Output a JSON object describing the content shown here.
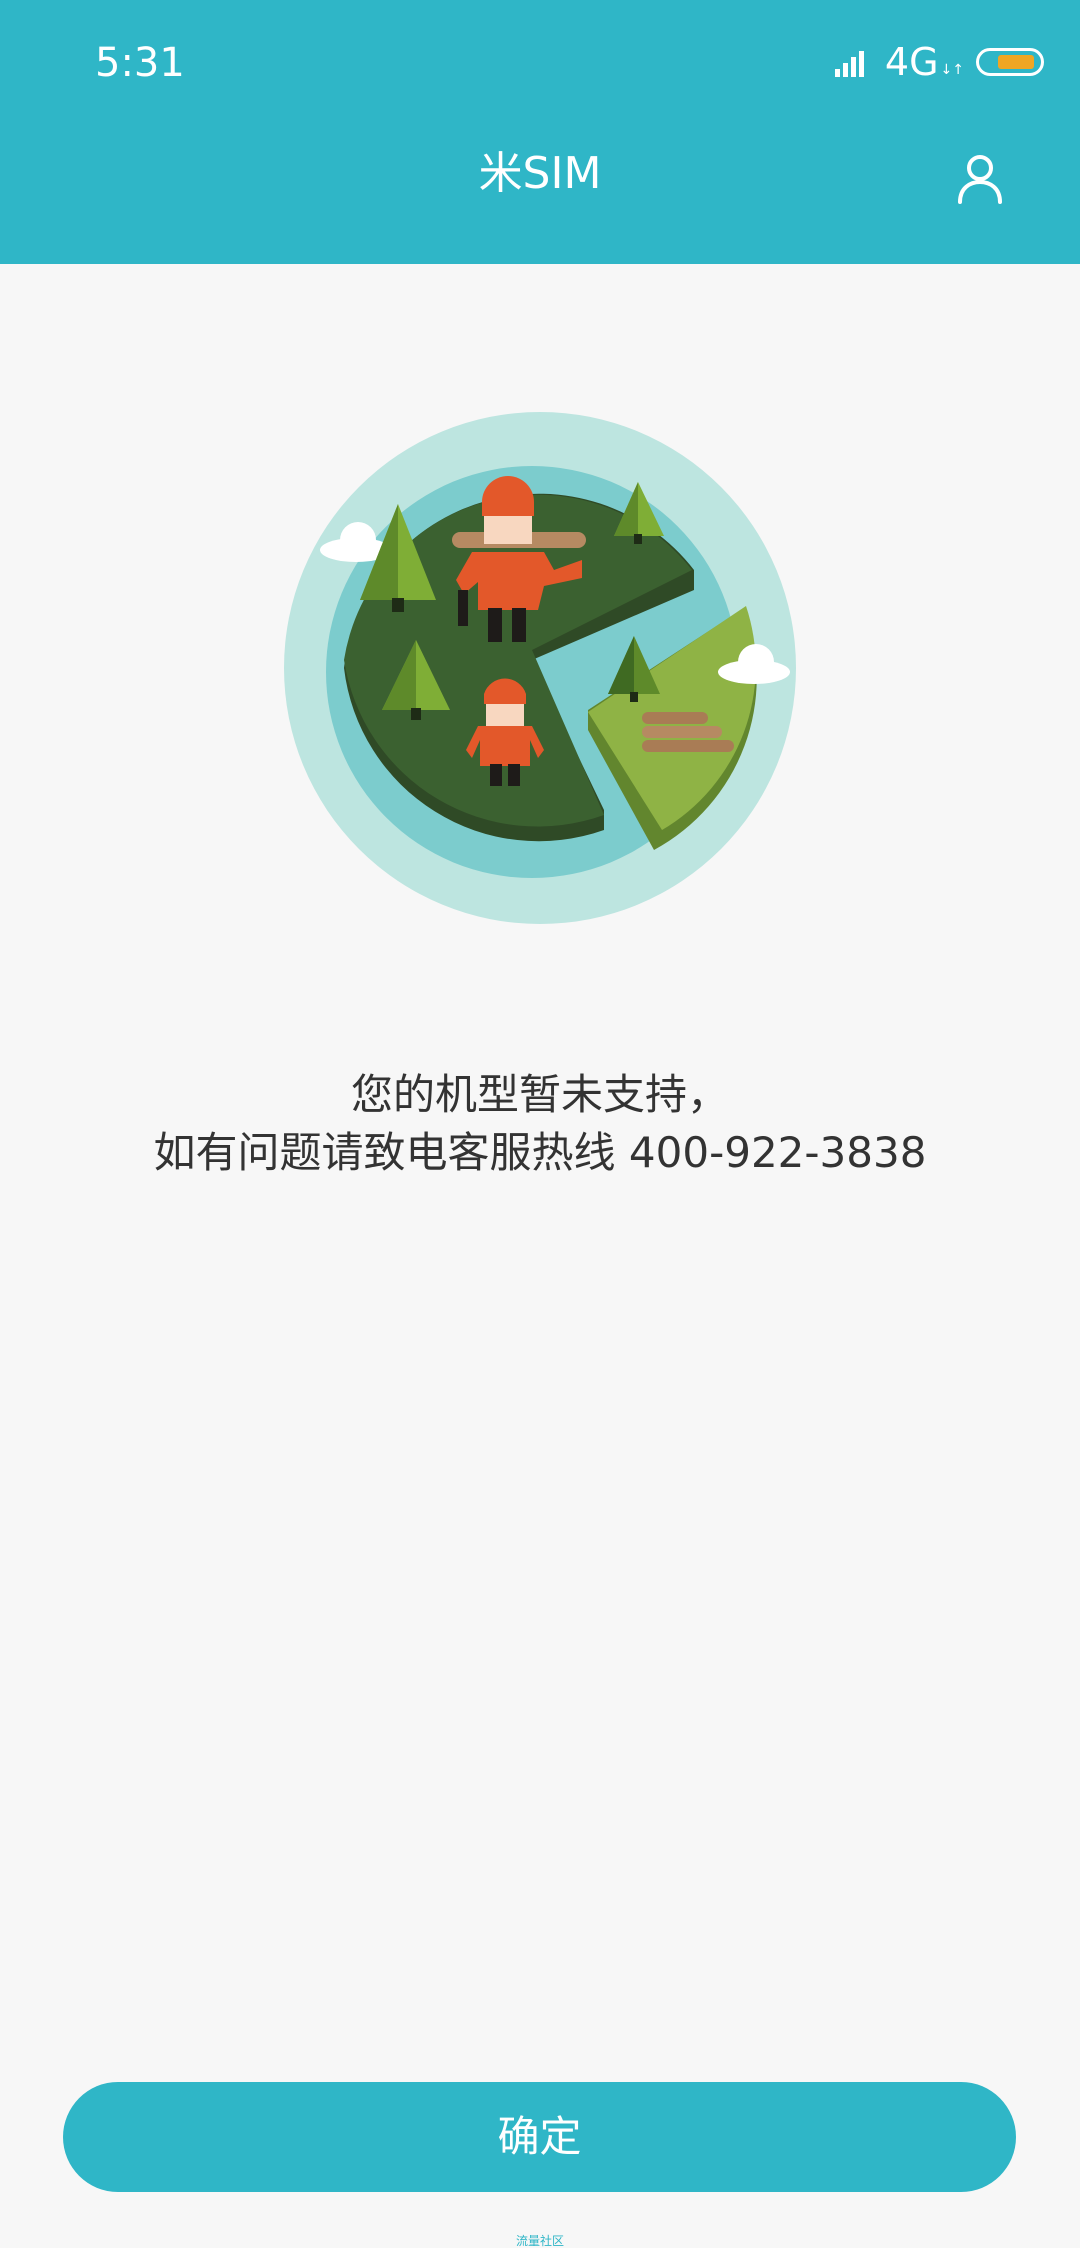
{
  "status_bar": {
    "time": "5:31",
    "network": "4G",
    "network_sub": "↓↑",
    "battery_color": "#f0a623"
  },
  "header": {
    "title": "米SIM",
    "profile_icon": "user-icon",
    "background": "#2fb6c7"
  },
  "main": {
    "illustration": "lumberjack-island-illustration",
    "message_line1": "您的机型暂未支持，",
    "message_line2": "如有问题请致电客服热线 400-922-3838"
  },
  "actions": {
    "confirm_label": "确定"
  },
  "footer": {
    "note": "流量社区"
  }
}
